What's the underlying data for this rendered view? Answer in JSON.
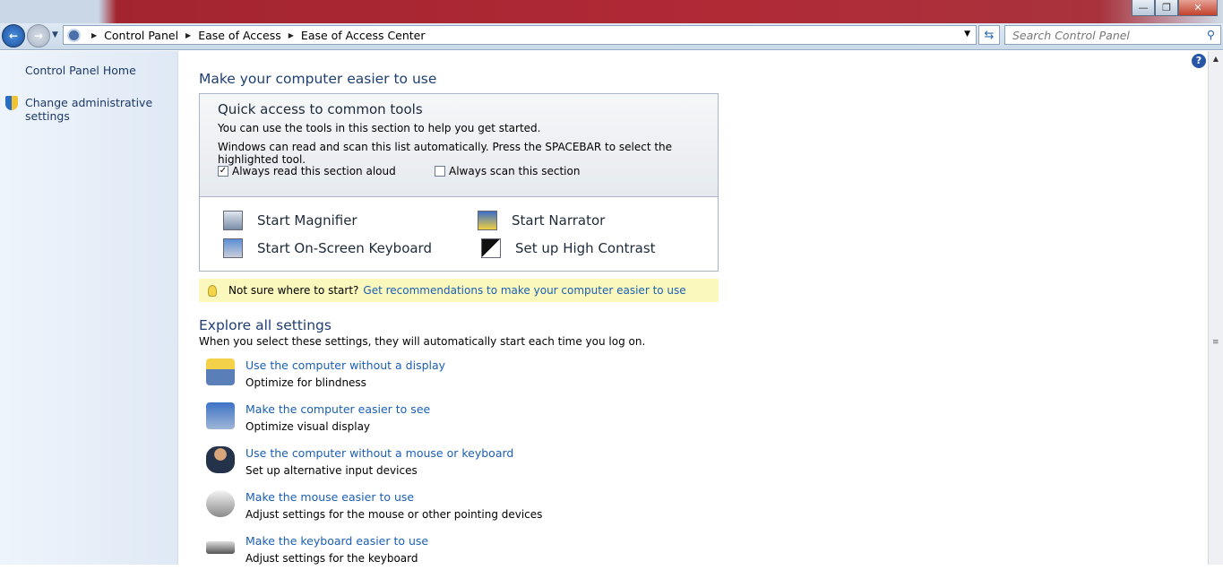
{
  "window": {
    "minimize": "—",
    "maximize": "❐",
    "close": "✕"
  },
  "address": {
    "crumbs": [
      "Control Panel",
      "Ease of Access",
      "Ease of Access Center"
    ],
    "search_placeholder": "Search Control Panel"
  },
  "sidebar": {
    "items": [
      {
        "label": "Control Panel Home"
      },
      {
        "label": "Change administrative settings"
      }
    ]
  },
  "main": {
    "title": "Make your computer easier to use",
    "quick": {
      "title": "Quick access to common tools",
      "line1": "You can use the tools in this section to help you get started.",
      "line2": "Windows can read and scan this list automatically.  Press the SPACEBAR to select the highlighted tool.",
      "cb1": {
        "label": "Always read this section aloud",
        "checked": true
      },
      "cb2": {
        "label": "Always scan this section",
        "checked": false
      },
      "tools": [
        "Start Magnifier",
        "Start Narrator",
        "Start On-Screen Keyboard",
        "Set up High Contrast"
      ]
    },
    "tip": {
      "text": "Not sure where to start?",
      "link": "Get recommendations to make your computer easier to use"
    },
    "explore": {
      "title": "Explore all settings",
      "subtitle": "When you select these settings, they will automatically start each time you log on.",
      "items": [
        {
          "link": "Use the computer without a display",
          "desc": "Optimize for blindness"
        },
        {
          "link": "Make the computer easier to see",
          "desc": "Optimize visual display"
        },
        {
          "link": "Use the computer without a mouse or keyboard",
          "desc": "Set up alternative input devices"
        },
        {
          "link": "Make the mouse easier to use",
          "desc": "Adjust settings for the mouse or other pointing devices"
        },
        {
          "link": "Make the keyboard easier to use",
          "desc": "Adjust settings for the keyboard"
        }
      ]
    }
  },
  "help": "?"
}
